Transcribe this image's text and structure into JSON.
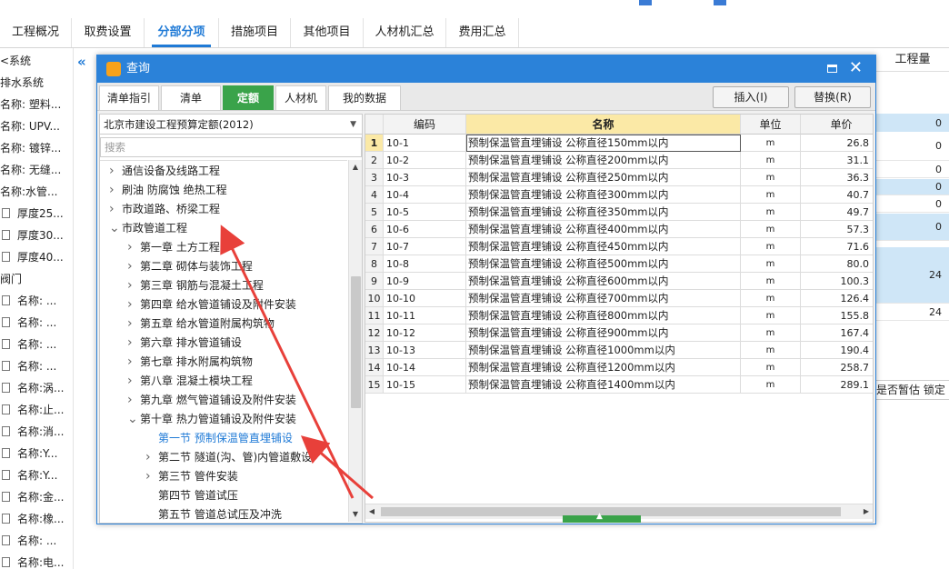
{
  "tabs": [
    "工程概况",
    "取费设置",
    "分部分项",
    "措施项目",
    "其他项目",
    "人材机汇总",
    "费用汇总"
  ],
  "active_tab": 2,
  "left_tree": [
    {
      "label": "<系统",
      "doc": false
    },
    {
      "label": "排水系统",
      "doc": false
    },
    {
      "label": "名称: 塑料...",
      "doc": false
    },
    {
      "label": "名称: UPV...",
      "doc": false
    },
    {
      "label": "名称: 镀锌...",
      "doc": false
    },
    {
      "label": "名称: 无缝...",
      "doc": false
    },
    {
      "label": "名称:水管...",
      "doc": false
    },
    {
      "label": "厚度25...",
      "doc": true
    },
    {
      "label": "厚度30...",
      "doc": true
    },
    {
      "label": "厚度40...",
      "doc": true
    },
    {
      "label": "阀门",
      "doc": false
    },
    {
      "label": "名称: ...",
      "doc": true
    },
    {
      "label": "名称: ...",
      "doc": true
    },
    {
      "label": "名称: ...",
      "doc": true
    },
    {
      "label": "名称: ...",
      "doc": true
    },
    {
      "label": "名称:涡...",
      "doc": true
    },
    {
      "label": "名称:止...",
      "doc": true
    },
    {
      "label": "名称:消...",
      "doc": true
    },
    {
      "label": "名称:Y...",
      "doc": true
    },
    {
      "label": "名称:Y...",
      "doc": true
    },
    {
      "label": "名称:金...",
      "doc": true
    },
    {
      "label": "名称:橡...",
      "doc": true
    },
    {
      "label": "名称: ...",
      "doc": true
    },
    {
      "label": "名称:电...",
      "doc": true
    }
  ],
  "background": {
    "col_header": "工程量",
    "cells": [
      "0",
      "0",
      "0",
      "0",
      "0",
      "0",
      "24",
      "24"
    ],
    "bottom_labels": "是否暂估  锁定"
  },
  "dialog": {
    "title": "查询",
    "tabs": [
      "清单指引",
      "清单",
      "定额",
      "人材机",
      "我的数据"
    ],
    "active_tab": 2,
    "insert_label": "插入(I)",
    "replace_label": "替换(R)",
    "library": "北京市建设工程预算定额(2012)",
    "search_placeholder": "搜索",
    "tree": [
      {
        "label": "通信设备及线路工程",
        "level": 0,
        "arrow": "right"
      },
      {
        "label": "刷油 防腐蚀 绝热工程",
        "level": 0,
        "arrow": "right"
      },
      {
        "label": "市政道路、桥梁工程",
        "level": 0,
        "arrow": "right"
      },
      {
        "label": "市政管道工程",
        "level": 0,
        "arrow": "down"
      },
      {
        "label": "第一章 土方工程",
        "level": 1,
        "arrow": "right"
      },
      {
        "label": "第二章 砌体与装饰工程",
        "level": 1,
        "arrow": "right"
      },
      {
        "label": "第三章 钢筋与混凝土工程",
        "level": 1,
        "arrow": "right"
      },
      {
        "label": "第四章 给水管道铺设及附件安装",
        "level": 1,
        "arrow": "right"
      },
      {
        "label": "第五章 给水管道附属构筑物",
        "level": 1,
        "arrow": "right"
      },
      {
        "label": "第六章 排水管道铺设",
        "level": 1,
        "arrow": "right"
      },
      {
        "label": "第七章 排水附属构筑物",
        "level": 1,
        "arrow": "right"
      },
      {
        "label": "第八章 混凝土模块工程",
        "level": 1,
        "arrow": "right"
      },
      {
        "label": "第九章 燃气管道铺设及附件安装",
        "level": 1,
        "arrow": "right"
      },
      {
        "label": "第十章 热力管道铺设及附件安装",
        "level": 1,
        "arrow": "down"
      },
      {
        "label": "第一节 预制保温管直埋铺设",
        "level": 2,
        "arrow": "none",
        "selected": true
      },
      {
        "label": "第二节 隧道(沟、管)内管道敷设",
        "level": 2,
        "arrow": "right"
      },
      {
        "label": "第三节 管件安装",
        "level": 2,
        "arrow": "right"
      },
      {
        "label": "第四节 管道试压",
        "level": 2,
        "arrow": "none"
      },
      {
        "label": "第五节 管道总试压及冲洗",
        "level": 2,
        "arrow": "none"
      }
    ],
    "grid_headers": {
      "code": "编码",
      "name": "名称",
      "unit": "单位",
      "price": "单价"
    },
    "rows": [
      {
        "code": "10-1",
        "name": "预制保温管直埋铺设 公称直径150mm以内",
        "unit": "m",
        "price": "26.8"
      },
      {
        "code": "10-2",
        "name": "预制保温管直埋铺设 公称直径200mm以内",
        "unit": "m",
        "price": "31.1"
      },
      {
        "code": "10-3",
        "name": "预制保温管直埋铺设 公称直径250mm以内",
        "unit": "m",
        "price": "36.3"
      },
      {
        "code": "10-4",
        "name": "预制保温管直埋铺设 公称直径300mm以内",
        "unit": "m",
        "price": "40.7"
      },
      {
        "code": "10-5",
        "name": "预制保温管直埋铺设 公称直径350mm以内",
        "unit": "m",
        "price": "49.7"
      },
      {
        "code": "10-6",
        "name": "预制保温管直埋铺设 公称直径400mm以内",
        "unit": "m",
        "price": "57.3"
      },
      {
        "code": "10-7",
        "name": "预制保温管直埋铺设 公称直径450mm以内",
        "unit": "m",
        "price": "71.6"
      },
      {
        "code": "10-8",
        "name": "预制保温管直埋铺设 公称直径500mm以内",
        "unit": "m",
        "price": "80.0"
      },
      {
        "code": "10-9",
        "name": "预制保温管直埋铺设 公称直径600mm以内",
        "unit": "m",
        "price": "100.3"
      },
      {
        "code": "10-10",
        "name": "预制保温管直埋铺设 公称直径700mm以内",
        "unit": "m",
        "price": "126.4"
      },
      {
        "code": "10-11",
        "name": "预制保温管直埋铺设 公称直径800mm以内",
        "unit": "m",
        "price": "155.8"
      },
      {
        "code": "10-12",
        "name": "预制保温管直埋铺设 公称直径900mm以内",
        "unit": "m",
        "price": "167.4"
      },
      {
        "code": "10-13",
        "name": "预制保温管直埋铺设 公称直径1000mm以内",
        "unit": "m",
        "price": "190.4"
      },
      {
        "code": "10-14",
        "name": "预制保温管直埋铺设 公称直径1200mm以内",
        "unit": "m",
        "price": "258.7"
      },
      {
        "code": "10-15",
        "name": "预制保温管直埋铺设 公称直径1400mm以内",
        "unit": "m",
        "price": "289.1"
      }
    ]
  },
  "colors": {
    "accent": "#2b82d9",
    "tab_active": "#1f7ad6",
    "dialog_tab_active": "#3aa34a",
    "header_highlight": "#fbe9a6",
    "annotation": "#e8403a"
  }
}
